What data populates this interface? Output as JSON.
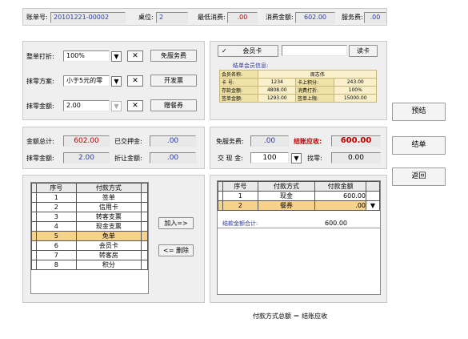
{
  "header": {
    "bill_no_label": "账单号:",
    "bill_no": "20101221-00002",
    "table_label": "桌位:",
    "table_value": "2",
    "min_consume_label": "最低消费:",
    "min_consume": ".00",
    "consume_total_label": "消费金额:",
    "consume_total": "602.00",
    "service_fee_label": "服务费:",
    "service_fee": ".00"
  },
  "discount": {
    "whole_discount_label": "整单打折:",
    "whole_discount_value": "100%",
    "rounding_label": "抹零方案:",
    "rounding_value": "小于5元的零",
    "rounding_amount_label": "抹零金额:",
    "rounding_amount_value": "2.00",
    "free_service_label": "免服务费",
    "invoice_label": "开发票",
    "gift_label": "赠餐券",
    "clear_symbol": "✕",
    "dropdown_symbol": "▼"
  },
  "member": {
    "check_symbol": "✓",
    "card_label": "会员卡",
    "card_input": "",
    "read_card_label": "读卡",
    "settle_info_title": "结单会员信息:",
    "rows": [
      [
        "会员名称:",
        "周志伟",
        "",
        ""
      ],
      [
        "卡  号:",
        "1234",
        "卡上积分:",
        "243.00"
      ],
      [
        "存款金额:",
        "4808.00",
        "消费打折:",
        "100%"
      ],
      [
        "签单金额:",
        "1293.00",
        "签单上限:",
        "15000.00"
      ]
    ]
  },
  "totals": {
    "amount_total_label": "金额总计:",
    "amount_total": "602.00",
    "deposit_label": "已交押金:",
    "deposit": ".00",
    "rounding_amount_label": "抹零金额:",
    "rounding_amount": "2.00",
    "discount_amount_label": "折让金额:",
    "discount_amount": ".00"
  },
  "settle": {
    "free_service_label": "免服务费:",
    "free_service_value": ".00",
    "receivable_label": "结账应收:",
    "receivable_value": "600.00",
    "cash_label": "交 现 金:",
    "cash_value": "100",
    "change_label": "找零:",
    "change_value": "0.00"
  },
  "pay_methods": {
    "headers": [
      "序号",
      "付款方式"
    ],
    "rows": [
      [
        "1",
        "签单"
      ],
      [
        "2",
        "信用卡"
      ],
      [
        "3",
        "转客支票"
      ],
      [
        "4",
        "现金支票"
      ],
      [
        "5",
        "免单"
      ],
      [
        "6",
        "会员卡"
      ],
      [
        "7",
        "转客房"
      ],
      [
        "8",
        "积分"
      ]
    ],
    "selected_index": 4
  },
  "transfer": {
    "add_label": "加入=>",
    "remove_label": "<= 删除"
  },
  "payments": {
    "headers": [
      "序号",
      "付款方式",
      "付款金额"
    ],
    "rows": [
      [
        "1",
        "现金",
        "600.00"
      ],
      [
        "2",
        "餐券",
        ".00"
      ]
    ],
    "selected_index": 1,
    "sum_label": "结款金额合计:",
    "sum_value": "600.00"
  },
  "footer_note": "付款方式总额 ＝ 结账应收",
  "actions": {
    "preclose_label": "预结",
    "close_label": "结单",
    "back_label": "返回"
  },
  "colors": {
    "panel_bg": "#f0eff0",
    "selected_row": "#f6d28b",
    "value_blue": "#2a3aa8",
    "value_red": "#c00000"
  }
}
